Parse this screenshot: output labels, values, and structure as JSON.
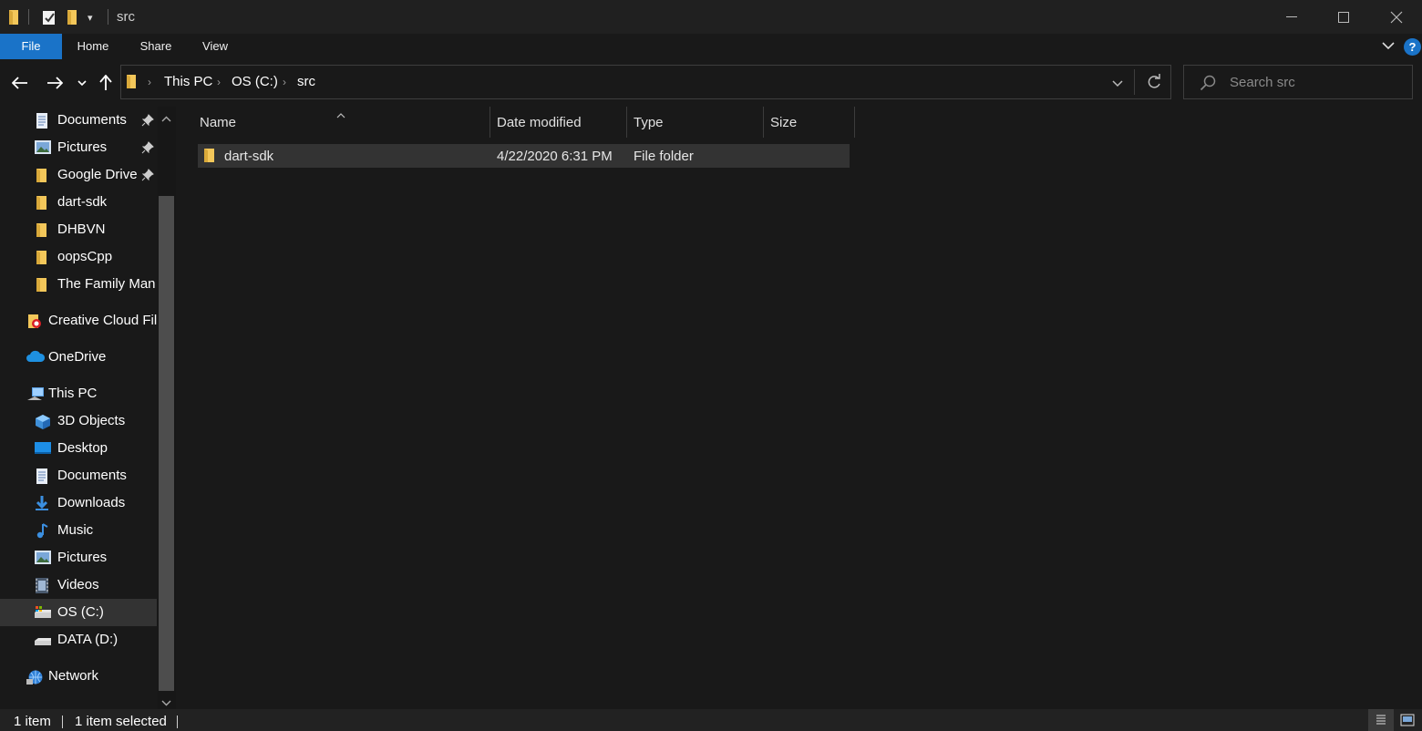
{
  "window": {
    "title": "src"
  },
  "ribbon": {
    "tabs": [
      "File",
      "Home",
      "Share",
      "View"
    ],
    "help_label": "?"
  },
  "address": {
    "crumbs": [
      "This PC",
      "OS (C:)",
      "src"
    ]
  },
  "search": {
    "placeholder": "Search src"
  },
  "sidebar": {
    "quick_access": [
      {
        "label": "Documents",
        "icon": "documents-icon",
        "pinned": true
      },
      {
        "label": "Pictures",
        "icon": "pictures-icon",
        "pinned": true
      },
      {
        "label": "Google Drive",
        "icon": "folder-icon",
        "pinned": true
      },
      {
        "label": "dart-sdk",
        "icon": "folder-icon",
        "pinned": false
      },
      {
        "label": "DHBVN",
        "icon": "folder-icon",
        "pinned": false
      },
      {
        "label": "oopsCpp",
        "icon": "folder-icon",
        "pinned": false
      },
      {
        "label": "The Family Man S",
        "icon": "folder-icon",
        "pinned": false
      }
    ],
    "creative_cloud": "Creative Cloud Files",
    "onedrive": "OneDrive",
    "this_pc": "This PC",
    "this_pc_items": [
      {
        "label": "3D Objects",
        "icon": "3d-objects-icon"
      },
      {
        "label": "Desktop",
        "icon": "desktop-icon"
      },
      {
        "label": "Documents",
        "icon": "documents-icon"
      },
      {
        "label": "Downloads",
        "icon": "downloads-icon"
      },
      {
        "label": "Music",
        "icon": "music-icon"
      },
      {
        "label": "Pictures",
        "icon": "pictures-icon"
      },
      {
        "label": "Videos",
        "icon": "videos-icon"
      },
      {
        "label": "OS (C:)",
        "icon": "drive-c-icon",
        "selected": true
      },
      {
        "label": "DATA (D:)",
        "icon": "drive-d-icon"
      }
    ],
    "network": "Network"
  },
  "columns": {
    "name": "Name",
    "date": "Date modified",
    "type": "Type",
    "size": "Size"
  },
  "files": [
    {
      "name": "dart-sdk",
      "date": "4/22/2020 6:31 PM",
      "type": "File folder",
      "size": ""
    }
  ],
  "status": {
    "count": "1 item",
    "selected": "1 item selected"
  },
  "colors": {
    "accent": "#1a73c8",
    "folder": "#f3c75a",
    "background": "#191919"
  }
}
